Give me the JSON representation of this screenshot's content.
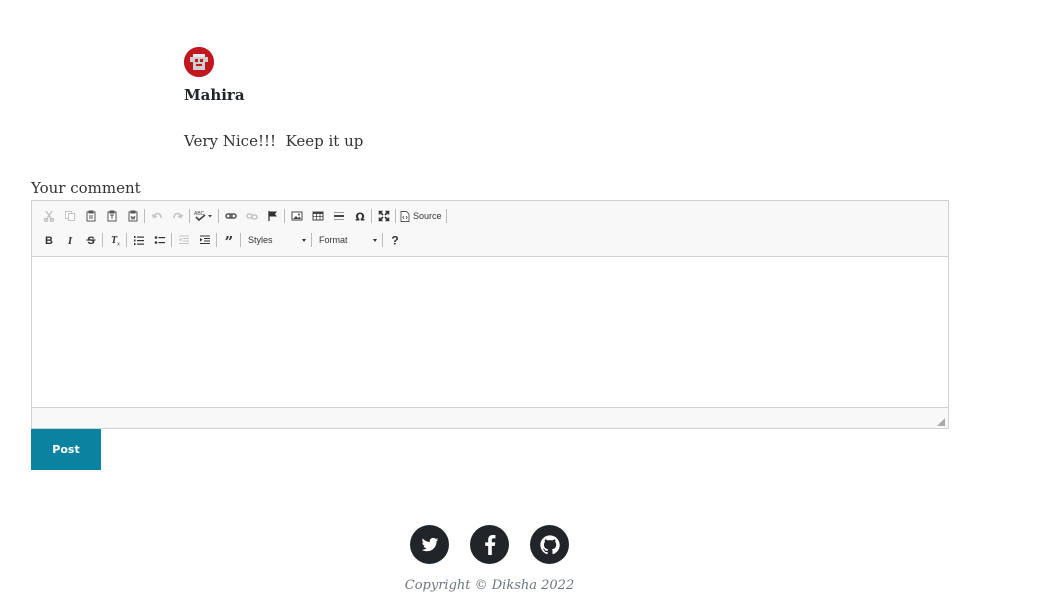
{
  "comment": {
    "author": "Mahira",
    "text": "Very Nice!!!  Keep it up",
    "avatar_color": "#c0181f"
  },
  "form": {
    "label": "Your comment",
    "post_label": "Post",
    "accent": "#0a83a0"
  },
  "editor": {
    "row1_icons": [
      "cut-icon",
      "copy-icon",
      "paste-icon",
      "paste-text-icon",
      "paste-word-icon",
      "undo-icon",
      "redo-icon",
      "spellcheck-icon",
      "link-icon",
      "unlink-icon",
      "anchor-icon",
      "image-icon",
      "table-icon",
      "horizontal-line-icon",
      "special-char-icon",
      "maximize-icon",
      "source-icon"
    ],
    "source_label": "Source",
    "row2_icons": [
      "bold-icon",
      "italic-icon",
      "strike-icon",
      "remove-format-icon",
      "numbered-list-icon",
      "bulleted-list-icon",
      "outdent-icon",
      "indent-icon",
      "blockquote-icon",
      "help-icon"
    ],
    "styles_label": "Styles",
    "format_label": "Format",
    "content": ""
  },
  "footer": {
    "social_icons": [
      "twitter-icon",
      "facebook-icon",
      "github-icon"
    ],
    "copyright": "Copyright © Diksha 2022"
  }
}
